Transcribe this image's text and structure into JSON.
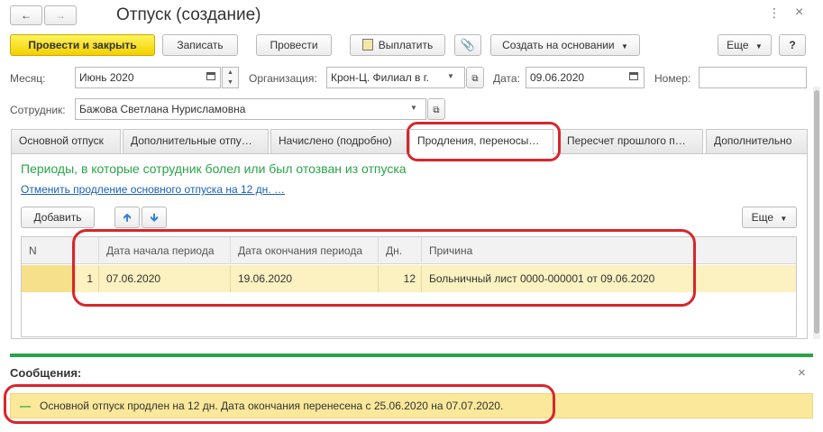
{
  "window": {
    "title": "Отпуск (создание)",
    "more_icon": "vertical-dots",
    "close_glyph": "×"
  },
  "nav": {
    "back_icon": "arrow-left",
    "forward_icon": "arrow-right"
  },
  "toolbar": {
    "post_close": "Провести и закрыть",
    "save": "Записать",
    "post": "Провести",
    "pay": "Выплатить",
    "create_based": "Создать на основании",
    "more": "Еще",
    "help": "?"
  },
  "header": {
    "month_label": "Месяц:",
    "month_value": "Июнь 2020",
    "org_label": "Организация:",
    "org_value": "Крон-Ц. Филиал в г.",
    "date_label": "Дата:",
    "date_value": "09.06.2020",
    "number_label": "Номер:",
    "number_value": "",
    "employee_label": "Сотрудник:",
    "employee_value": "Бажова Светлана Нурисламовна"
  },
  "tabs": [
    {
      "label": "Основной отпуск"
    },
    {
      "label": "Дополнительные отпу…"
    },
    {
      "label": "Начислено (подробно)"
    },
    {
      "label": "Продления, переносы…"
    },
    {
      "label": "Пересчет прошлого п…"
    },
    {
      "label": "Дополнительно"
    }
  ],
  "panel": {
    "heading": "Периоды, в которые сотрудник болел или был отозван из отпуска",
    "link": "Отменить продление основного отпуска на 12 дн. …",
    "add_button": "Добавить",
    "more_button": "Еще"
  },
  "table": {
    "columns": [
      "N",
      "",
      "Дата начала периода",
      "Дата окончания периода",
      "Дн.",
      "Причина"
    ],
    "rows": [
      {
        "index": "1",
        "start": "07.06.2020",
        "end": "19.06.2020",
        "days": "12",
        "reason": "Больничный лист 0000-000001 от 09.06.2020"
      }
    ]
  },
  "messages": {
    "title": "Сообщения:",
    "close_glyph": "×",
    "item": "Основной отпуск продлен на 12 дн. Дата окончания перенесена с 25.06.2020 на 07.07.2020.",
    "item_bullet": "—"
  },
  "colors": {
    "accent_green": "#2aa34a",
    "highlight_red": "#d7262c",
    "primary_yellow": "#f3d000",
    "row_selected": "#fbf1c1",
    "link_blue": "#1a5fb4"
  }
}
